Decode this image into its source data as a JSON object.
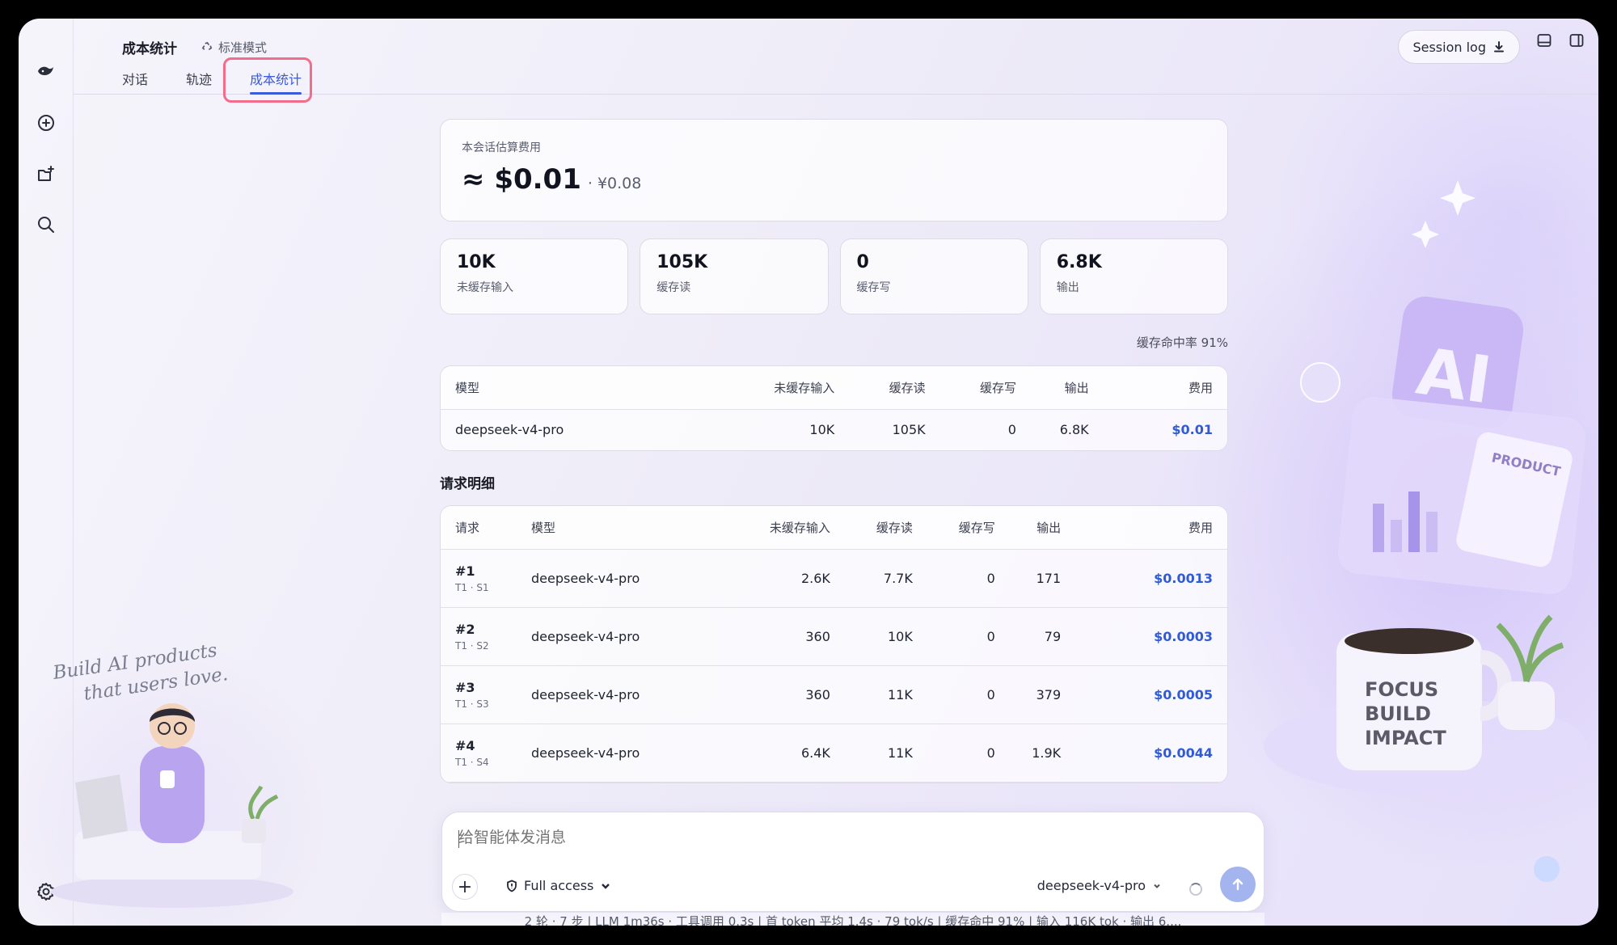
{
  "header": {
    "title": "成本统计",
    "mode_label": "标准模式",
    "tabs": [
      {
        "label": "对话",
        "active": false
      },
      {
        "label": "轨迹",
        "active": false
      },
      {
        "label": "成本统计",
        "active": true
      }
    ],
    "session_log_label": "Session log"
  },
  "cost": {
    "label": "本会话估算费用",
    "usd": "≈ $0.01",
    "cny": "· ¥0.08"
  },
  "stats": [
    {
      "value": "10K",
      "label": "未缓存输入"
    },
    {
      "value": "105K",
      "label": "缓存读"
    },
    {
      "value": "0",
      "label": "缓存写"
    },
    {
      "value": "6.8K",
      "label": "输出"
    }
  ],
  "hit_rate": "缓存命中率 91%",
  "model_table": {
    "headers": [
      "模型",
      "未缓存输入",
      "缓存读",
      "缓存写",
      "输出",
      "费用"
    ],
    "rows": [
      {
        "model": "deepseek-v4-pro",
        "uncached": "10K",
        "cache_read": "105K",
        "cache_write": "0",
        "output": "6.8K",
        "fee": "$0.01"
      }
    ]
  },
  "requests": {
    "title": "请求明细",
    "headers": [
      "请求",
      "模型",
      "未缓存输入",
      "缓存读",
      "缓存写",
      "输出",
      "费用"
    ],
    "rows": [
      {
        "id": "#1",
        "sub": "T1 · S1",
        "model": "deepseek-v4-pro",
        "uncached": "2.6K",
        "cache_read": "7.7K",
        "cache_write": "0",
        "output": "171",
        "fee": "$0.0013"
      },
      {
        "id": "#2",
        "sub": "T1 · S2",
        "model": "deepseek-v4-pro",
        "uncached": "360",
        "cache_read": "10K",
        "cache_write": "0",
        "output": "79",
        "fee": "$0.0003"
      },
      {
        "id": "#3",
        "sub": "T1 · S3",
        "model": "deepseek-v4-pro",
        "uncached": "360",
        "cache_read": "11K",
        "cache_write": "0",
        "output": "379",
        "fee": "$0.0005"
      },
      {
        "id": "#4",
        "sub": "T1 · S4",
        "model": "deepseek-v4-pro",
        "uncached": "6.4K",
        "cache_read": "11K",
        "cache_write": "0",
        "output": "1.9K",
        "fee": "$0.0044"
      }
    ]
  },
  "composer": {
    "placeholder": "给智能体发消息",
    "access_label": "Full access",
    "model_label": "deepseek-v4-pro"
  },
  "status_bar": "2 轮 · 7 步 | LLM 1m36s · 工具调用 0.3s | 首 token 平均 1.4s · 79 tok/s | 缓存命中 91% | 输入 116K tok · 输出 6....",
  "decor": {
    "slogan_line1": "Build AI products",
    "slogan_line2": "that users love.",
    "ai_badge": "AI",
    "product_label": "PRODUCT",
    "mug_lines": [
      "FOCUS",
      "BUILD",
      "IMPACT"
    ]
  },
  "icons": [
    "logo-icon",
    "new-chat-icon",
    "new-project-icon",
    "search-icon",
    "settings-icon",
    "download-icon",
    "panel-bottom-icon",
    "panel-right-icon",
    "shield-icon",
    "chevron-down-icon",
    "plus-icon",
    "send-arrow-icon",
    "loading-spinner-icon"
  ],
  "colors": {
    "accent": "#3b5bdb",
    "fee": "#2f5ad8",
    "highlight": "#f26d8b",
    "send": "#a3b4ee"
  }
}
